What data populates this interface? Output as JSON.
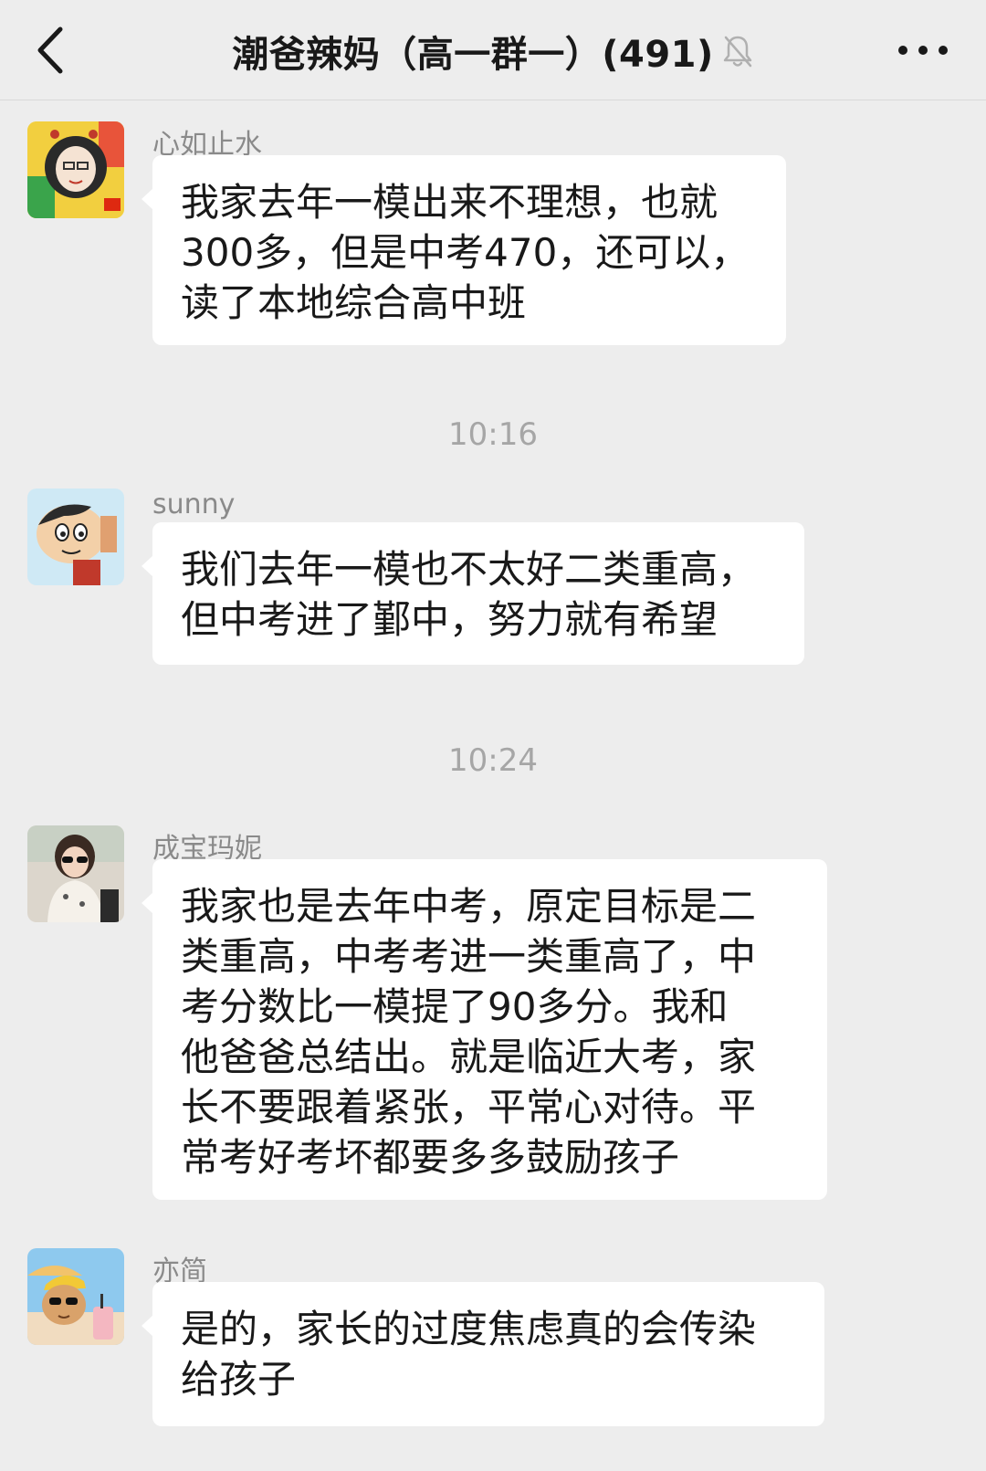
{
  "header": {
    "title": "潮爸辣妈（高一群一）(491)",
    "back_icon": "chevron-left-icon",
    "mute_icon": "bell-muted-icon",
    "more_icon": "more-dots-icon"
  },
  "timestamps": [
    "10:16",
    "10:24"
  ],
  "messages": [
    {
      "sender": "心如止水",
      "text": "我家去年一模出来不理想，也就\n300多，但是中考470，还可以，\n读了本地综合高中班"
    },
    {
      "sender": "sunny",
      "text": "我们去年一模也不太好二类重高，\n但中考进了鄞中，努力就有希望"
    },
    {
      "sender": "成宝玛妮",
      "text": "我家也是去年中考，原定目标是二\n类重高，中考考进一类重高了，中\n考分数比一模提了90多分。我和\n他爸爸总结出。就是临近大考，家\n长不要跟着紧张，平常心对待。平\n常考好考坏都要多多鼓励孩子"
    },
    {
      "sender": "亦简",
      "text": "是的，家长的过度焦虑真的会传染\n给孩子"
    }
  ]
}
